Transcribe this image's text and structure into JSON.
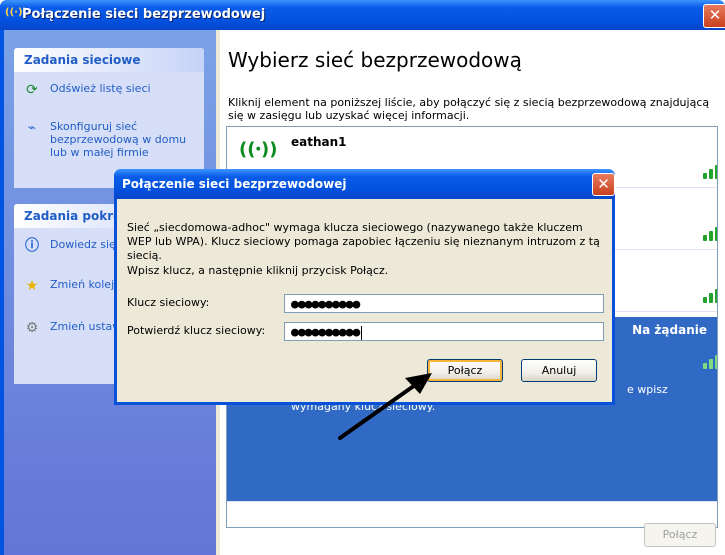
{
  "window": {
    "title": "Połączenie sieci bezprzewodowej",
    "close_glyph": "✕"
  },
  "left_pane": {
    "network_tasks": {
      "header": "Zadania sieciowe",
      "items": [
        {
          "label": "Odśwież listę sieci",
          "icon": "refresh-icon"
        },
        {
          "label": "Skonfiguruj sieć bezprzewodową w domu lub w małej firmie",
          "icon": "setup-network-icon"
        }
      ]
    },
    "related_tasks": {
      "header": "Zadania pokre",
      "items": [
        {
          "label": "Dowiedz się bezprzewod",
          "icon": "info-icon"
        },
        {
          "label": "Zmień kolejn preferowany",
          "icon": "star-icon"
        },
        {
          "label": "Zmień ustaw zaawansowa",
          "icon": "settings-icon"
        }
      ]
    }
  },
  "main": {
    "heading": "Wybierz sieć bezprzewodową",
    "instruction": "Kliknij element na poniższej liście, aby połączyć się z siecią bezprzewodową znajdującą się w zasięgu lub uzyskać więcej informacji.",
    "networks": [
      {
        "name": "eathan1",
        "icon": "wireless-antenna-icon",
        "signal": 0.8
      },
      {
        "name": "",
        "signal": 0.8
      },
      {
        "name": "",
        "signal": 0.6
      }
    ],
    "selected_network": {
      "status": "Na żądanie",
      "description_tail": "e wpisz",
      "description": "wymagany klucz sieciowy."
    },
    "connect_button": "Połącz"
  },
  "dialog": {
    "title": "Połączenie sieci bezprzewodowej",
    "close_glyph": "✕",
    "message": "Sieć „siecdomowa-adhoc\" wymaga klucza sieciowego (nazywanego także kluczem WEP lub WPA). Klucz sieciowy pomaga zapobiec łączeniu się nieznanym intruzom z tą siecią.",
    "prompt": "Wpisz klucz, a następnie kliknij przycisk Połącz.",
    "key_label": "Klucz sieciowy:",
    "key_value": "●●●●●●●●●●",
    "confirm_label": "Potwierdź klucz sieciowy:",
    "confirm_value": "●●●●●●●●●●",
    "ok_label": "Połącz",
    "cancel_label": "Anuluj"
  },
  "colors": {
    "titlebar": "#0a5ce8",
    "selection": "#316ac5",
    "signal": "#22a32a",
    "task_link": "#215dc6"
  }
}
